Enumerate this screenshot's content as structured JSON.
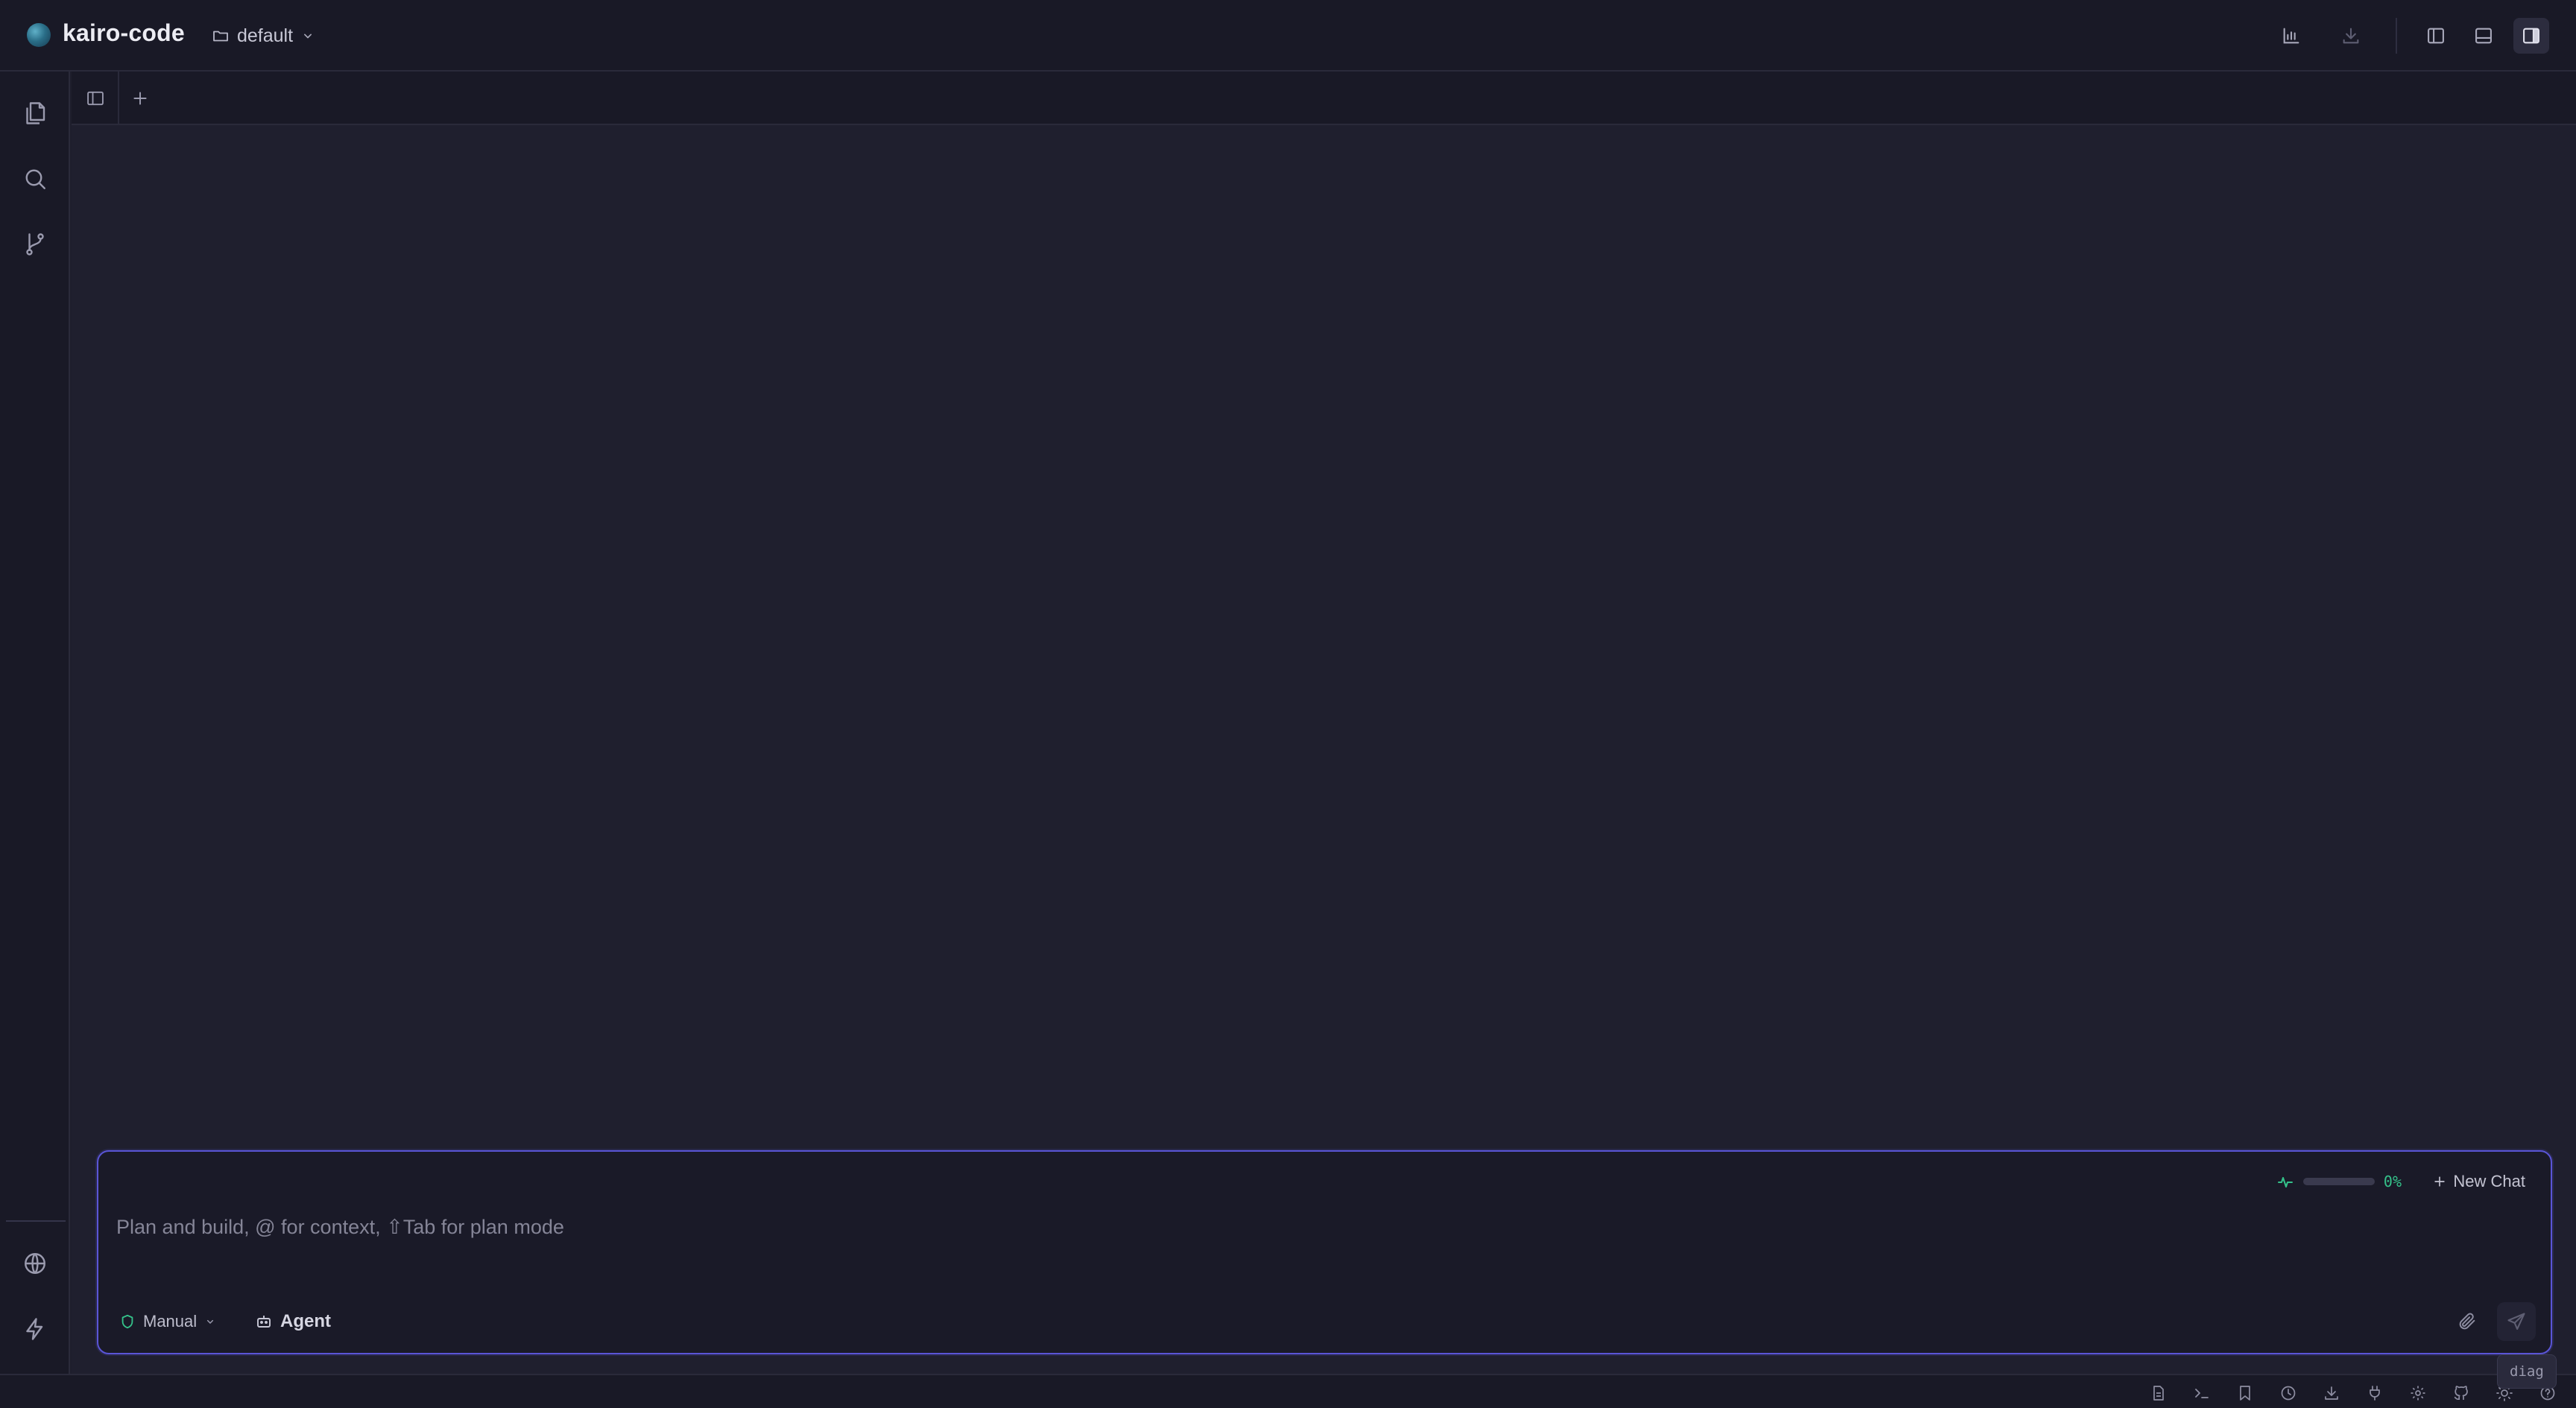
{
  "app": {
    "title": "kairo-code",
    "project": "default"
  },
  "titlebar_icons": [
    "chart-icon",
    "download-icon",
    "left-panel-icon",
    "bottom-panel-icon",
    "right-panel-icon"
  ],
  "activity_bar": {
    "top": [
      "files-icon",
      "search-icon",
      "git-branch-icon"
    ],
    "bottom": [
      "globe-icon",
      "lightning-icon"
    ]
  },
  "chat": {
    "placeholder": "Plan and build, @ for context, ⇧Tab for plan mode",
    "context_percent": "0%",
    "context_fraction": 0,
    "new_chat_label": "New Chat",
    "mode_label": "Manual",
    "agent_label": "Agent"
  },
  "status_bar": {
    "icons": [
      "document-icon",
      "terminal-icon",
      "bookmark-icon",
      "clock-icon",
      "download-icon",
      "plug-icon",
      "settings-icon",
      "github-icon",
      "sun-icon",
      "help-icon"
    ],
    "diag_label": "diag"
  },
  "colors": {
    "accent": "#5a55d6",
    "context_green": "#34c28a",
    "background": "#1f1f2e"
  }
}
